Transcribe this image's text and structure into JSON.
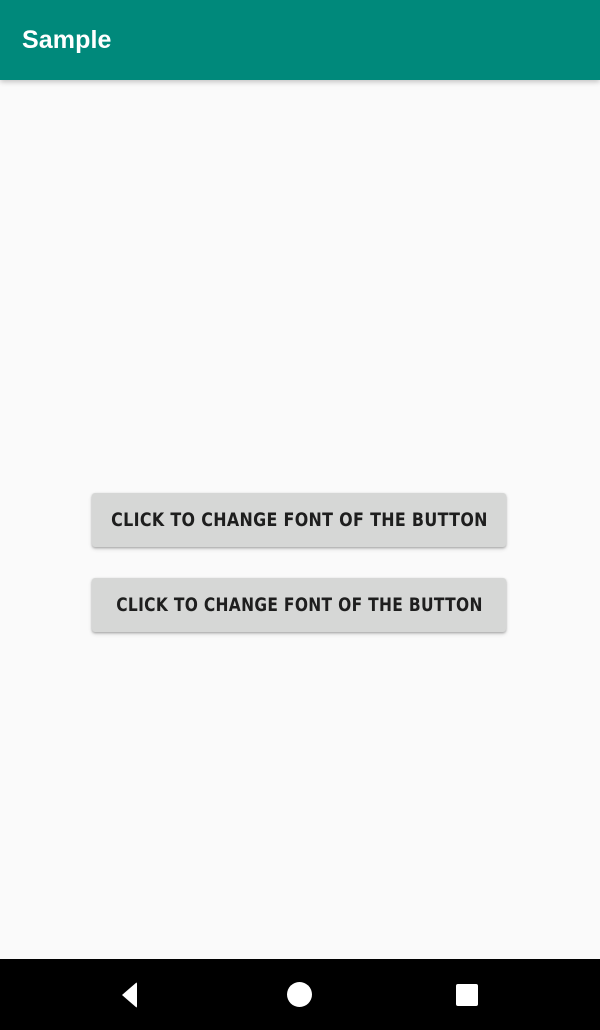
{
  "appbar": {
    "title": "Sample",
    "background_color": "#00897B",
    "title_color": "#FFFFFF"
  },
  "content": {
    "background_color": "#FAFAFA",
    "buttons": [
      {
        "label": "CLICK TO CHANGE FONT OF THE BUTTON",
        "fill_color": "#D6D7D6",
        "text_color": "#1E1E1E"
      },
      {
        "label": "CLICK TO CHANGE FONT OF THE BUTTON",
        "fill_color": "#D6D7D6",
        "text_color": "#1E1E1E"
      }
    ]
  },
  "navbar": {
    "background_color": "#000000",
    "items": [
      {
        "icon": "back-triangle-icon",
        "label": "Back"
      },
      {
        "icon": "home-circle-icon",
        "label": "Home"
      },
      {
        "icon": "recents-square-icon",
        "label": "Recents"
      }
    ]
  }
}
